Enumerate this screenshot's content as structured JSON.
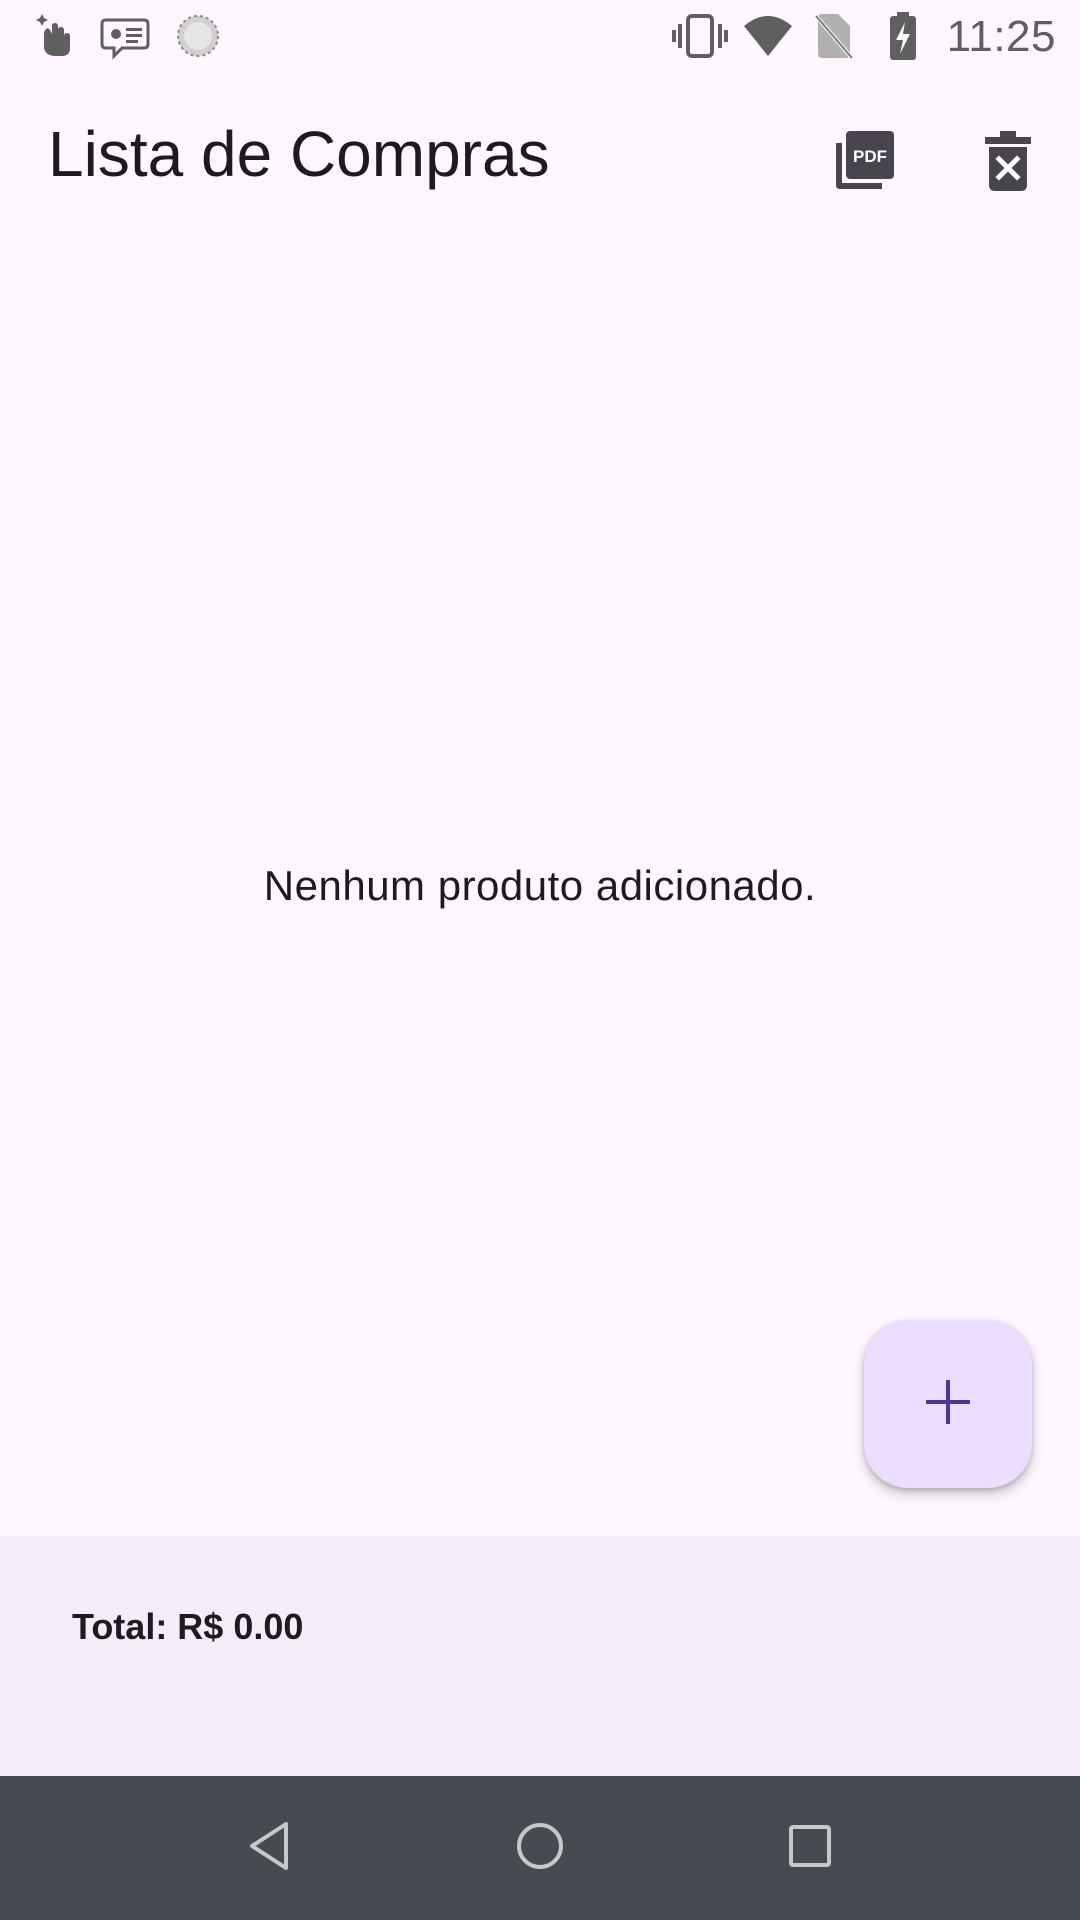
{
  "status_bar": {
    "time": "11:25",
    "left_icons": [
      "gesture-hand-icon",
      "message-card-icon",
      "sync-circle-icon"
    ],
    "right_icons": [
      "vibrate-icon",
      "wifi-icon",
      "no-sim-icon",
      "battery-charging-icon"
    ]
  },
  "app_bar": {
    "title": "Lista de Compras",
    "actions": [
      {
        "name": "export-pdf",
        "icon": "pdf-icon",
        "label": "PDF"
      },
      {
        "name": "clear-list",
        "icon": "delete-forever-icon"
      }
    ]
  },
  "main": {
    "empty_message": "Nenhum produto adicionado."
  },
  "fab": {
    "icon": "add-icon"
  },
  "bottom_bar": {
    "total_label": "Total: R$ 0.00"
  },
  "nav_bar": {
    "buttons": [
      "back-icon",
      "home-icon",
      "recents-icon"
    ]
  },
  "colors": {
    "background": "#fef7ff",
    "fab_background": "#eaddff",
    "fab_icon": "#4f378b",
    "bottom_bar": "#f3edf7",
    "nav_bar": "#454b50",
    "text": "#1d1b20",
    "app_icons": "#49454f"
  }
}
